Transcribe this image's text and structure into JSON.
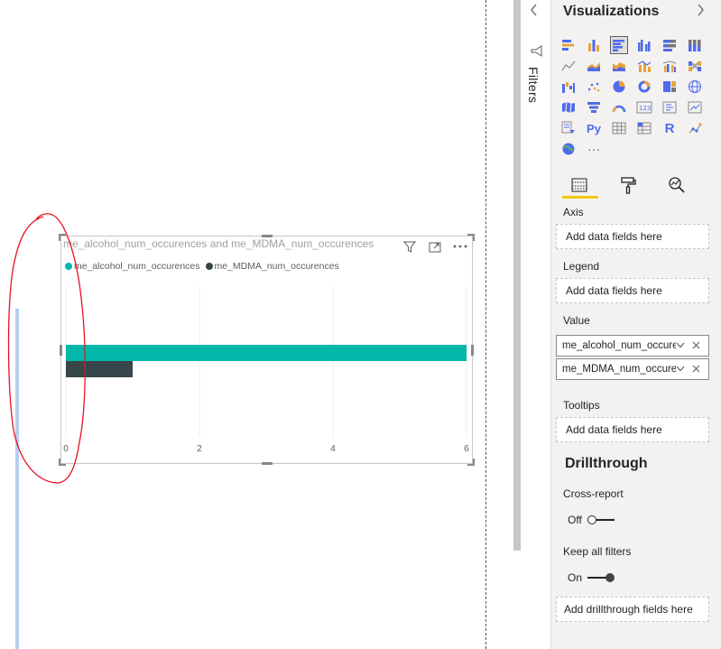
{
  "visual": {
    "title": "me_alcohol_num_occurences and me_MDMA_num_occurences",
    "legend": [
      {
        "label": "me_alcohol_num_occurences",
        "color": "#01b8aa"
      },
      {
        "label": "me_MDMA_num_occurences",
        "color": "#374649"
      }
    ]
  },
  "chart_data": {
    "type": "bar",
    "orientation": "horizontal",
    "categories": [
      ""
    ],
    "series": [
      {
        "name": "me_alcohol_num_occurences",
        "values": [
          6
        ],
        "color": "#01b8aa"
      },
      {
        "name": "me_MDMA_num_occurences",
        "values": [
          1
        ],
        "color": "#374649"
      }
    ],
    "xlim": [
      0,
      6
    ],
    "x_ticks": [
      "0",
      "2",
      "4",
      "6"
    ],
    "grid": true,
    "legend_position": "top-left"
  },
  "filters": {
    "label": "Filters"
  },
  "viz_pane": {
    "title": "Visualizations",
    "wells": {
      "axis_label": "Axis",
      "axis_placeholder": "Add data fields here",
      "legend_label": "Legend",
      "legend_placeholder": "Add data fields here",
      "value_label": "Value",
      "value_fields": [
        "me_alcohol_num_occurences",
        "me_MDMA_num_occurences"
      ],
      "tooltips_label": "Tooltips",
      "tooltips_placeholder": "Add data fields here"
    },
    "drillthrough": {
      "title": "Drillthrough",
      "cross_report_label": "Cross-report",
      "cross_report_state": "Off",
      "keep_filters_label": "Keep all filters",
      "keep_filters_state": "On",
      "placeholder": "Add drillthrough fields here"
    },
    "python_label": "Py",
    "r_label": "R",
    "more_label": "···"
  },
  "colors": {
    "accent": "#f2c811",
    "annotation": "#e81123"
  }
}
